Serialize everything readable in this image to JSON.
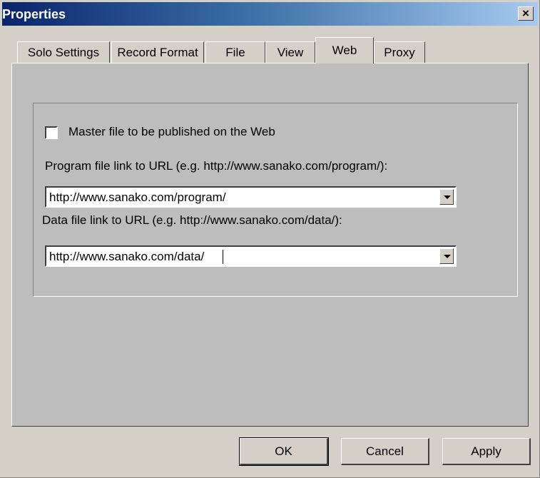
{
  "window": {
    "title": "Properties",
    "close_symbol": "×"
  },
  "tabs": [
    {
      "label": "Solo Settings"
    },
    {
      "label": "Record Format"
    },
    {
      "label": "File"
    },
    {
      "label": "View"
    },
    {
      "label": "Web",
      "active": true
    },
    {
      "label": "Proxy"
    }
  ],
  "web": {
    "master_checkbox_label": "Master file to be published on the Web",
    "master_checked": false,
    "program_label": "Program file link to URL (e.g. http://www.sanako.com/program/):",
    "program_value": "http://www.sanako.com/program/",
    "data_label": "Data file link to URL (e.g. http://www.sanako.com/data/):",
    "data_value": "http://www.sanako.com/data/"
  },
  "buttons": {
    "ok": "OK",
    "cancel": "Cancel",
    "apply": "Apply"
  }
}
